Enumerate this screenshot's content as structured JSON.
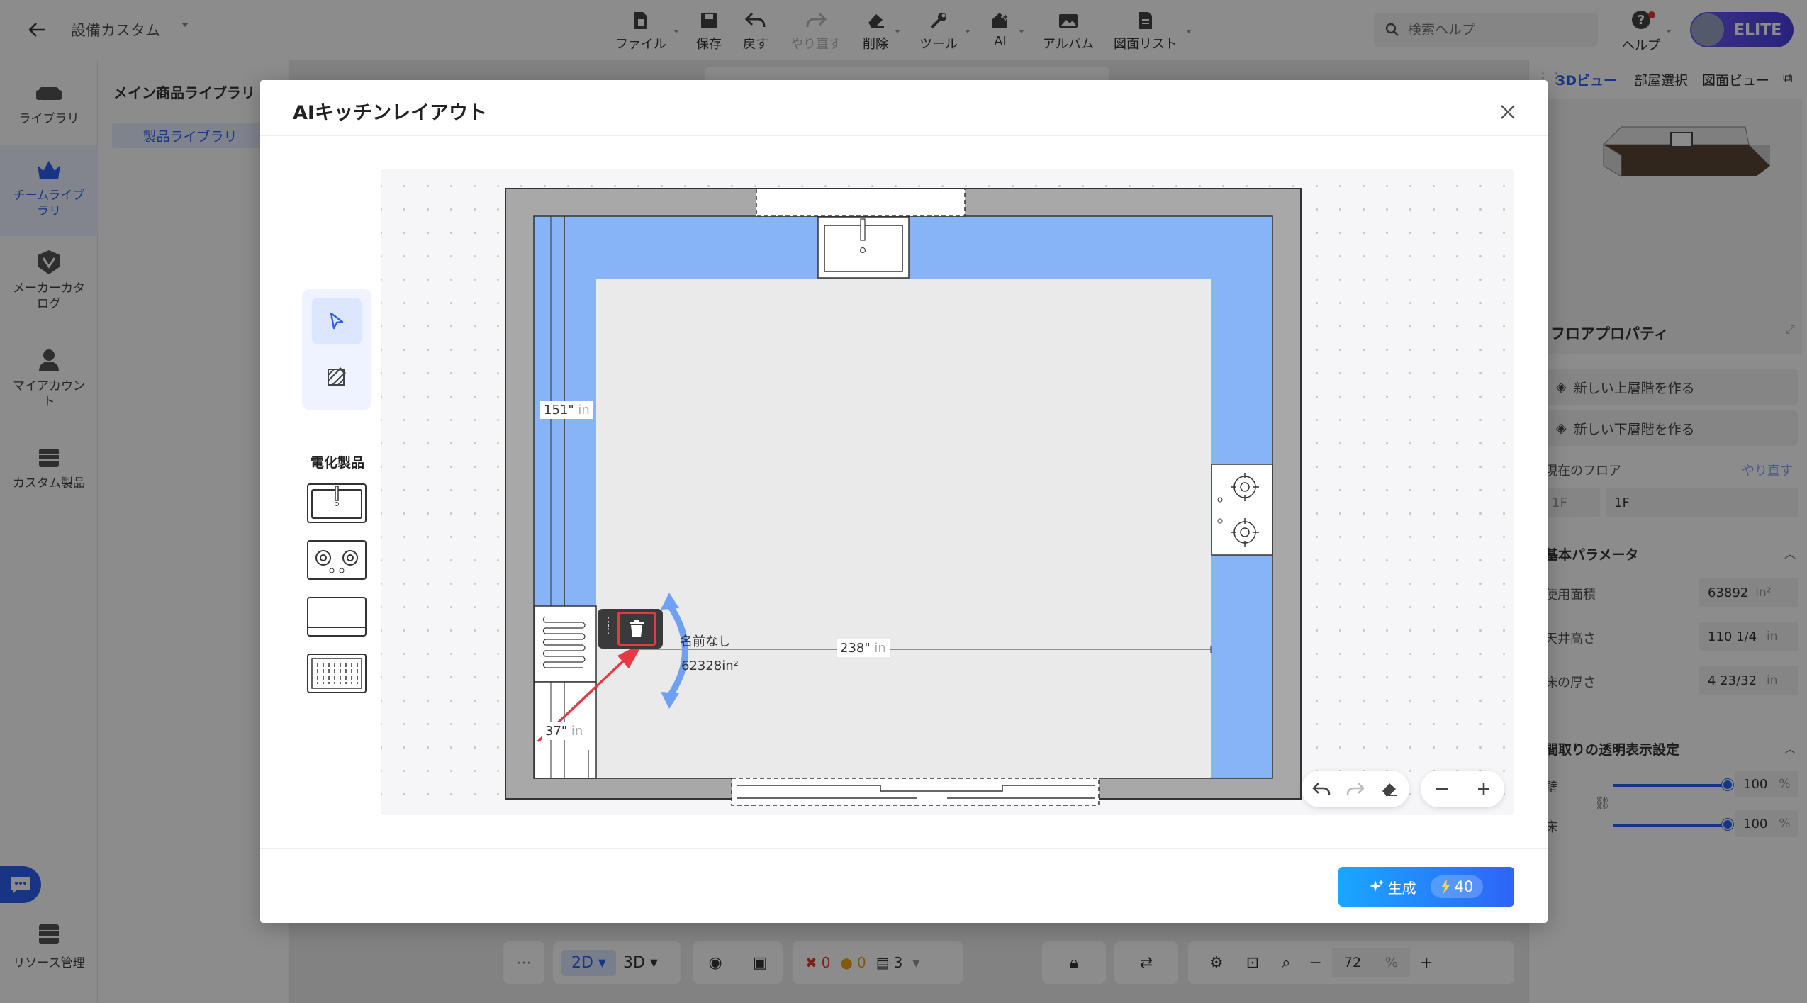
{
  "topbar": {
    "project_name": "設備カスタム",
    "tools": [
      {
        "label": "ファイル",
        "icon": "file-icon"
      },
      {
        "label": "保存",
        "icon": "save-icon"
      },
      {
        "label": "戻す",
        "icon": "undo-icon"
      },
      {
        "label": "やり直す",
        "icon": "redo-icon",
        "disabled": true
      },
      {
        "label": "削除",
        "icon": "eraser-icon"
      },
      {
        "label": "ツール",
        "icon": "wrench-icon"
      },
      {
        "label": "AI",
        "icon": "ai-house-icon"
      },
      {
        "label": "アルバム",
        "icon": "album-icon"
      },
      {
        "label": "図面リスト",
        "icon": "drawing-list-icon"
      }
    ],
    "search_placeholder": "検索ヘルプ",
    "help_label": "ヘルプ",
    "plan_badge": "ELITE"
  },
  "leftnav": {
    "items": [
      {
        "label": "ライブラリ",
        "icon": "sofa-icon"
      },
      {
        "label": "チームライブラリ",
        "icon": "crown-icon",
        "active": true
      },
      {
        "label": "メーカーカタログ",
        "icon": "catalog-icon"
      },
      {
        "label": "マイアカウント",
        "icon": "user-icon"
      },
      {
        "label": "カスタム製品",
        "icon": "custom-product-icon"
      }
    ],
    "resource_label": "リソース管理"
  },
  "library": {
    "title": "メイン商品ライブラリ",
    "tab": "製品ライブラリ"
  },
  "rightpanel": {
    "tabs": [
      "3Dビュー",
      "部屋選択",
      "図面ビュー"
    ],
    "section_title": "フロアプロパティ",
    "buttons": [
      "新しい上層階を作る",
      "新しい下層階を作る"
    ],
    "current_floor_label": "現在のフロア",
    "current_floor_action": "やり直す",
    "floor_select_placeholder": "1F",
    "floor_value": "1F",
    "params_title": "基本パラメータ",
    "params": [
      {
        "label": "使用面積",
        "value": "63892",
        "unit": "in²"
      },
      {
        "label": "天井高さ",
        "value": "110 1/4",
        "unit": "in"
      },
      {
        "label": "床の厚さ",
        "value": "4 23/32",
        "unit": "in"
      }
    ],
    "transparency_title": "間取りの透明表示設定",
    "sliders": [
      {
        "label": "壁",
        "value": "100",
        "unit": "%",
        "level": 1.0
      },
      {
        "label": "床",
        "value": "100",
        "unit": "%",
        "level": 1.0
      }
    ]
  },
  "bottombar": {
    "view_2d": "2D",
    "view_3d": "3D",
    "errors": "0",
    "warnings": "0",
    "layers": "3",
    "zoom": "72",
    "zoom_unit": "%"
  },
  "modal": {
    "title": "AIキッチンレイアウト",
    "palette_title": "電化製品",
    "palette_items": [
      "sink-icon",
      "cooktop-icon",
      "oven-icon",
      "dishwasher-icon"
    ],
    "dimensions": [
      {
        "value": "151\"",
        "unit": "in"
      },
      {
        "value": "238\"",
        "unit": "in"
      },
      {
        "value": "37\"",
        "unit": "in"
      }
    ],
    "room_name": "名前なし",
    "room_area": "62328in²",
    "generate_label": "生成",
    "generate_cost": "40",
    "colors": {
      "counter": "#87b4f7",
      "wall": "#a8a8a8",
      "floor": "#eaeaea",
      "accent": "#2b62f0",
      "delete_highlight": "#e53945"
    }
  }
}
